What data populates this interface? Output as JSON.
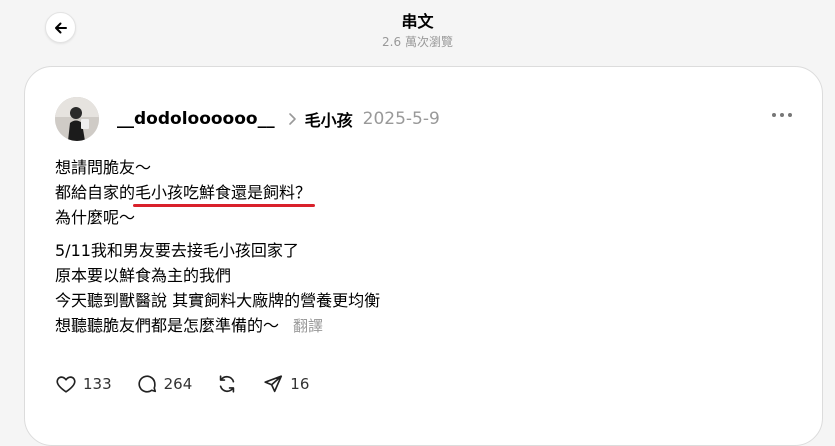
{
  "header": {
    "title": "串文",
    "views": "2.6 萬次瀏覽"
  },
  "post": {
    "username": "__dodoloooooo__",
    "topic": "毛小孩",
    "date": "2025-5-9",
    "lines_a": [
      "想請問脆友～",
      "都給自家的",
      "毛小孩吃鮮食還是飼料？",
      "為什麼呢～"
    ],
    "lines_b": [
      "5/11我和男友要去接毛小孩回家了",
      "原本要以鮮食為主的我們",
      "今天聽到獸醫說 其實飼料大廠牌的營養更均衡",
      "想聽聽脆友們都是怎麼準備的～"
    ],
    "translate_label": "翻譯"
  },
  "actions": {
    "likes": "133",
    "comments": "264",
    "shares": "16"
  },
  "colors": {
    "highlight": "#d9212b",
    "muted": "#999999"
  },
  "icons": [
    "back-arrow-icon",
    "chevron-right-icon",
    "more-dots-icon",
    "heart-icon",
    "comment-icon",
    "repost-icon",
    "share-icon"
  ]
}
